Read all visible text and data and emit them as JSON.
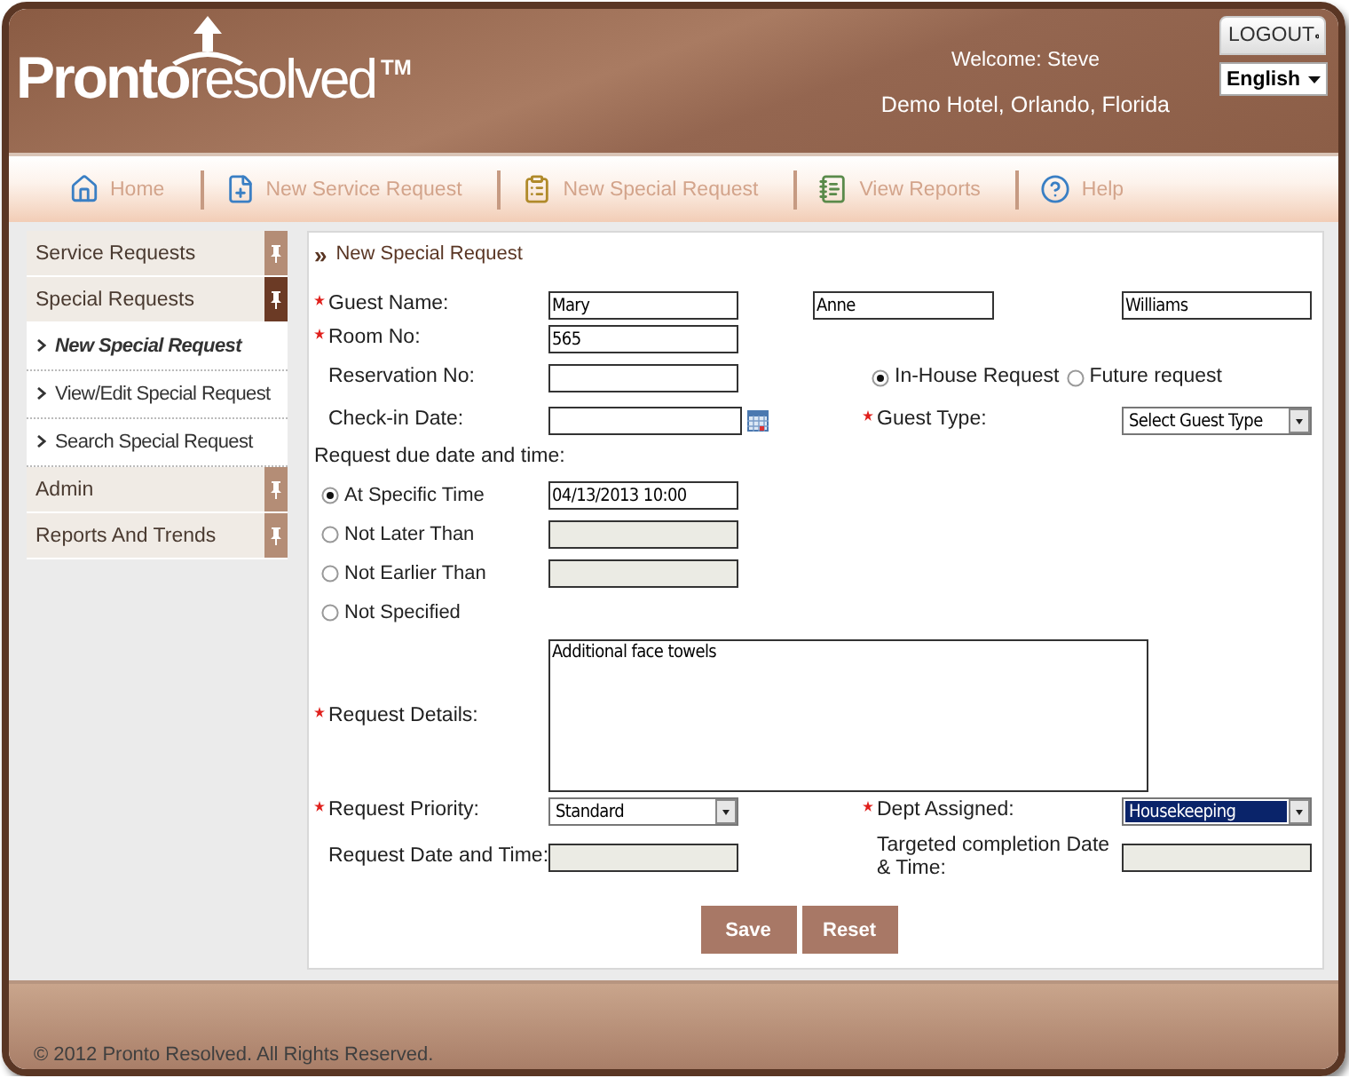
{
  "header": {
    "logo": {
      "bold": "Pronto",
      "light": "resolved",
      "mark": "TM"
    },
    "welcome": "Welcome: Steve",
    "hotel": "Demo Hotel, Orlando, Florida",
    "logout": "LOGOUT",
    "language": "English"
  },
  "nav": [
    {
      "label": "Home",
      "kind": "home"
    },
    {
      "label": "New Service Request",
      "kind": "add"
    },
    {
      "label": "New Special Request",
      "kind": "special"
    },
    {
      "label": "View Reports",
      "kind": "reports"
    },
    {
      "label": "Help",
      "kind": "help"
    }
  ],
  "sidebar": [
    {
      "label": "Service Requests",
      "expanded": false
    },
    {
      "label": "Special Requests",
      "expanded": true,
      "children": [
        {
          "label": "New Special Request",
          "selected": true
        },
        {
          "label": "View/Edit Special Request",
          "selected": false
        },
        {
          "label": "Search Special Request",
          "selected": false
        }
      ]
    },
    {
      "label": "Admin",
      "expanded": false
    },
    {
      "label": "Reports And Trends",
      "expanded": false
    }
  ],
  "form": {
    "title_marker": "»",
    "title": "New Special Request",
    "guest_name": {
      "label": "Guest Name:",
      "required": true,
      "values": [
        "Mary",
        "Anne",
        "Williams"
      ]
    },
    "room_no": {
      "label": "Room No:",
      "required": true,
      "value": "565"
    },
    "reservation_no": {
      "label": "Reservation No:",
      "required": false
    },
    "request_types": [
      {
        "label": "In-House Request",
        "selected": true
      },
      {
        "label": "Future request",
        "selected": false
      }
    ],
    "checkin_date": {
      "label": "Check-in Date:",
      "required": false
    },
    "guest_type": {
      "label": "Guest Type:",
      "required": true,
      "value": "Select Guest Type",
      "highlighted": false
    },
    "due": {
      "label": "Request due date and time:",
      "options": [
        {
          "label": "At Specific Time",
          "selected": true,
          "kind": "field",
          "value": "04/13/2013 10:00",
          "disabled": false
        },
        {
          "label": "Not Later Than",
          "selected": false,
          "kind": "field",
          "disabled": true
        },
        {
          "label": "Not Earlier Than",
          "selected": false,
          "kind": "field",
          "disabled": true
        },
        {
          "label": "Not Specified",
          "selected": false,
          "kind": "plain"
        }
      ]
    },
    "details": {
      "label": "Request Details:",
      "required": true,
      "value": "Additional face towels"
    },
    "priority": {
      "label": "Request Priority:",
      "required": true,
      "value": "Standard",
      "highlighted": false
    },
    "dept": {
      "label": "Dept Assigned:",
      "required": true,
      "value": "Housekeeping",
      "highlighted": true
    },
    "request_date": {
      "label": "Request Date and Time:",
      "required": false,
      "disabled": true
    },
    "targeted": {
      "label": "Targeted completion Date & Time:",
      "required": false,
      "disabled": true
    },
    "buttons": [
      "Save",
      "Reset"
    ]
  },
  "footer": "© 2012 Pronto Resolved. All Rights Reserved."
}
